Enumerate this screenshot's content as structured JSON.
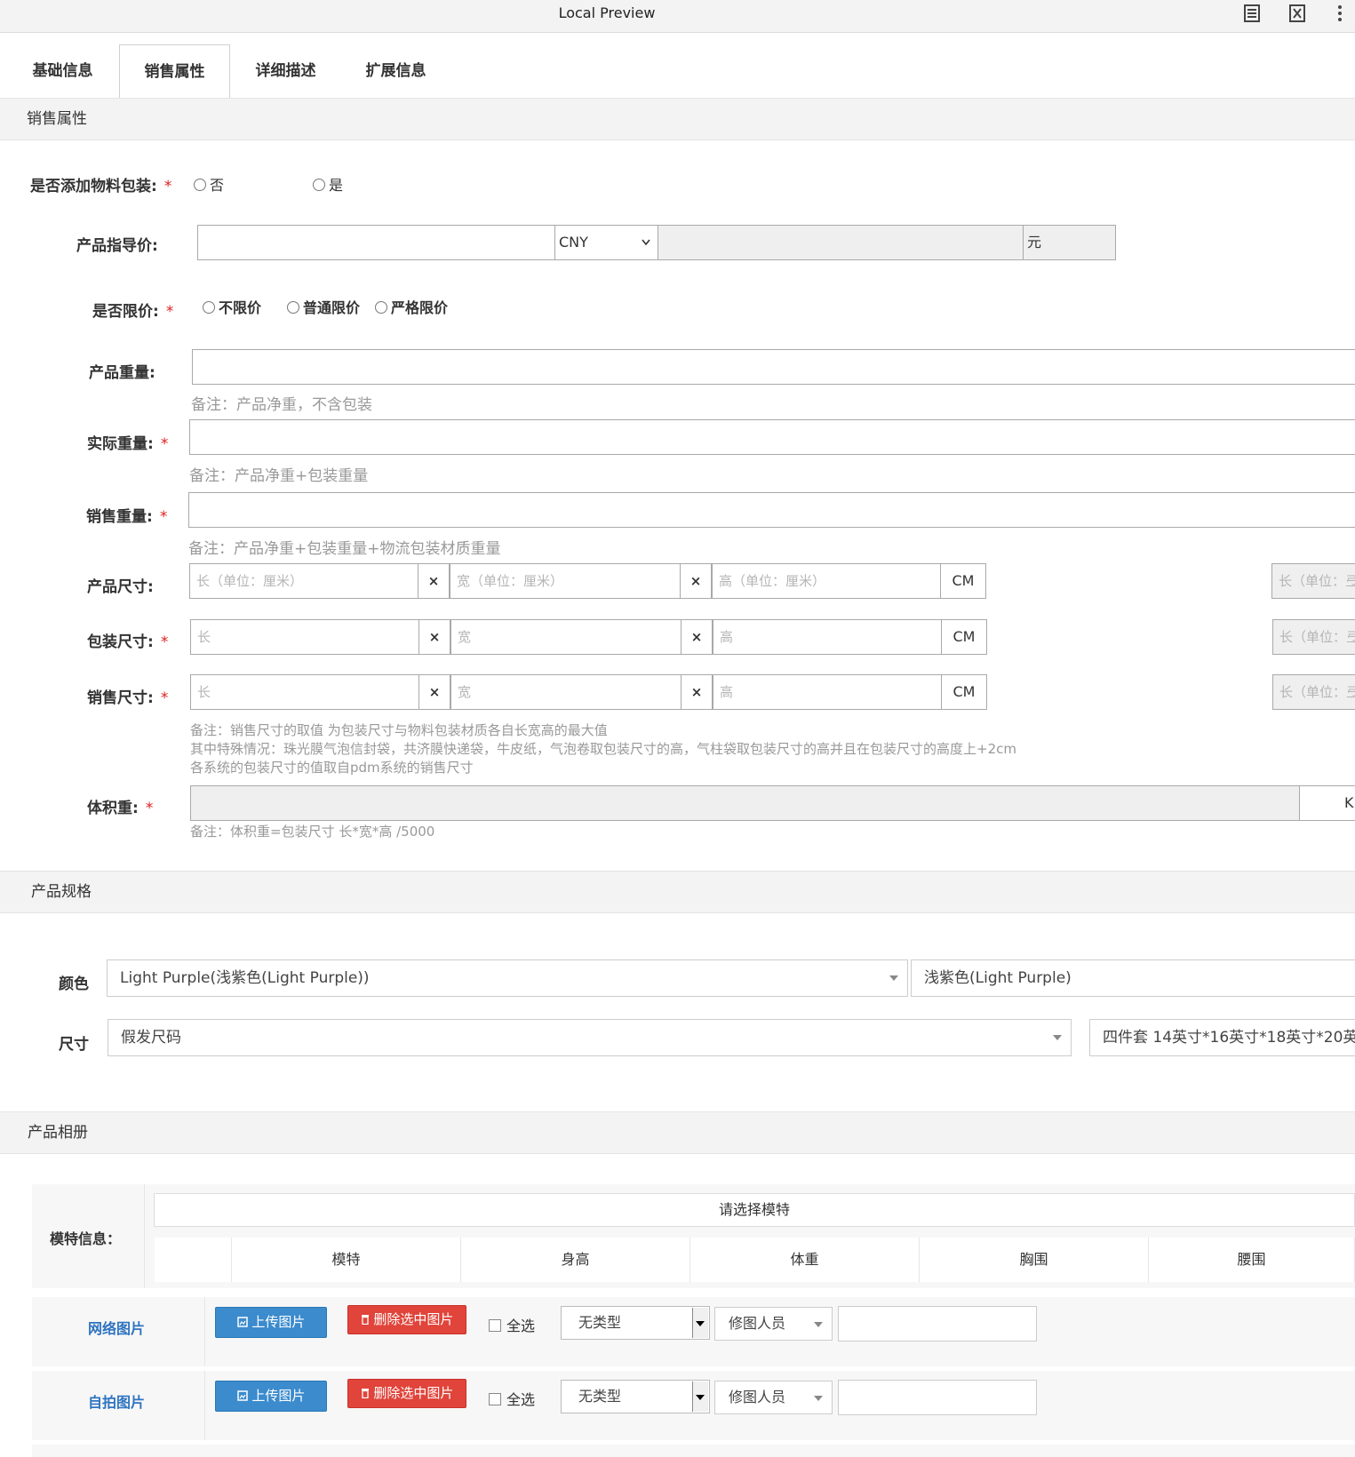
{
  "window": {
    "title": "Local Preview"
  },
  "tabs": [
    "基础信息",
    "销售属性",
    "详细描述",
    "扩展信息"
  ],
  "sections": {
    "sales": "销售属性",
    "spec": "产品规格",
    "album": "产品相册"
  },
  "material_pack": {
    "label": "是否添加物料包装:",
    "options": [
      "否",
      "是"
    ]
  },
  "guide_price": {
    "label": "产品指导价:",
    "currency": "CNY",
    "unit": "元"
  },
  "price_limit": {
    "label": "是否限价:",
    "options": [
      "不限价",
      "普通限价",
      "严格限价"
    ]
  },
  "product_weight": {
    "label": "产品重量:",
    "note": "备注：产品净重，不含包装"
  },
  "actual_weight": {
    "label": "实际重量:",
    "note": "备注：产品净重+包装重量"
  },
  "sale_weight": {
    "label": "销售重量:",
    "note": "备注：产品净重+包装重量+物流包装材质重量"
  },
  "product_size": {
    "label": "产品尺寸:",
    "ph_l": "长（单位：厘米）",
    "ph_w": "宽（单位：厘米）",
    "ph_h": "高（单位：厘米）",
    "unit": "CM",
    "side_ph": "长（单位：弖"
  },
  "pack_size": {
    "label": "包装尺寸:",
    "ph_l": "长",
    "ph_w": "宽",
    "ph_h": "高",
    "unit": "CM",
    "side_ph": "长（单位：弖"
  },
  "sale_size": {
    "label": "销售尺寸:",
    "ph_l": "长",
    "ph_w": "宽",
    "ph_h": "高",
    "unit": "CM",
    "side_ph": "长（单位：弖"
  },
  "size_notes": [
    "备注：销售尺寸的取值 为包装尺寸与物料包装材质各自长宽高的最大值",
    "其中特殊情况：珠光膜气泡信封袋，共济膜快递袋，牛皮纸，气泡卷取包装尺寸的高，气柱袋取包装尺寸的高并且在包装尺寸的高度上+2cm",
    "各系统的包装尺寸的值取自pdm系统的销售尺寸"
  ],
  "volume_weight": {
    "label": "体积重:",
    "unit_partial": "K",
    "note": "备注：体积重=包装尺寸 长*宽*高 /5000"
  },
  "spec": {
    "color_label": "颜色",
    "color_value": "Light Purple(浅紫色(Light Purple))",
    "color_extra": "浅紫色(Light Purple)",
    "size_label": "尺寸",
    "size_value": "假发尺码",
    "size_extra": "四件套 14英寸*16英寸*18英寸*20英"
  },
  "model": {
    "label": "模特信息：",
    "select_placeholder": "请选择模特",
    "columns": [
      "",
      "模特",
      "身高",
      "体重",
      "胸围",
      "腰围"
    ]
  },
  "image_rows": [
    {
      "label": "网络图片",
      "upload": "上传图片",
      "delete": "删除选中图片",
      "select_all": "全选",
      "type": "无类型",
      "editor": "修图人员"
    },
    {
      "label": "自拍图片",
      "upload": "上传图片",
      "delete": "删除选中图片",
      "select_all": "全选",
      "type": "无类型",
      "editor": "修图人员"
    }
  ],
  "colors": {
    "required": "#e02020",
    "blue_button": "#3b8bcd",
    "red_button": "#e0443a",
    "link_blue": "#2f74c0"
  }
}
